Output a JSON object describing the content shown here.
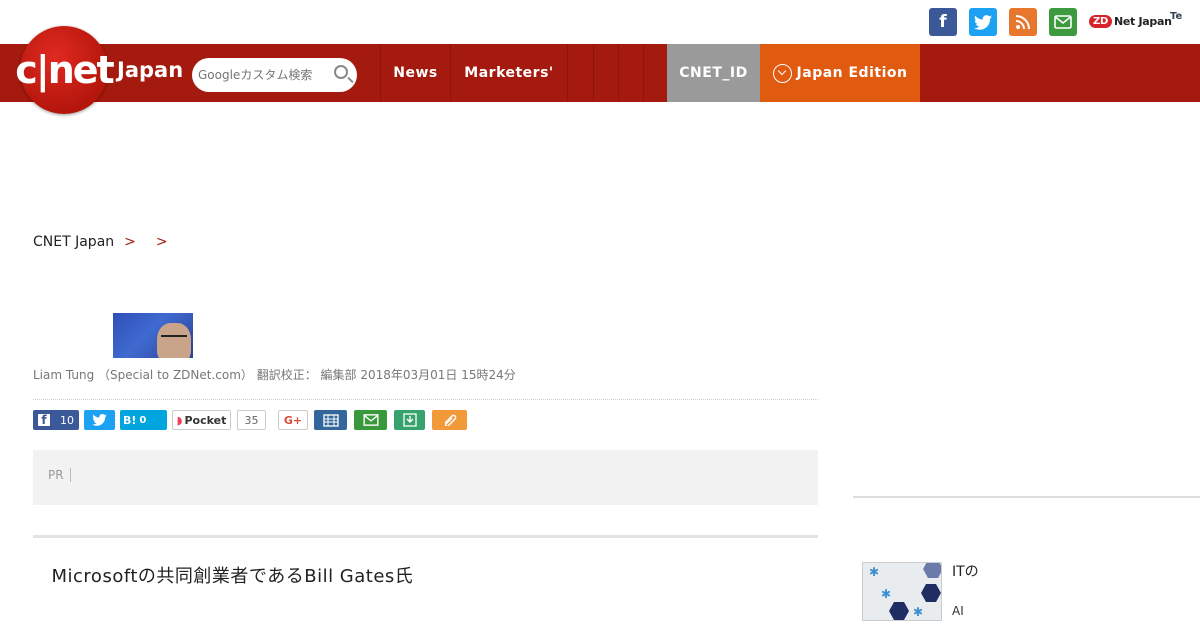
{
  "header": {
    "logo_text": "c|net",
    "edition_label": "Japan",
    "search_placeholder": "Googleカスタム検索",
    "nav": {
      "news": "News",
      "marketers": "Marketers'",
      "e1": "",
      "e2": "",
      "e3": "",
      "e4": "",
      "cnet_id": "CNET_ID",
      "japan_edition": "Japan Edition"
    },
    "social": {
      "zdnet_badge": "ZD",
      "zdnet_text": "Net Japan",
      "tech_text": "Te"
    }
  },
  "breadcrumb": {
    "home": "CNET Japan",
    "sep": ">",
    "level1": "",
    "level2": ""
  },
  "article": {
    "title": "",
    "byline": "Liam Tung （Special to ZDNet.com） 翻訳校正： 編集部  2018年03月01日 15時24分",
    "share": {
      "fb_count": "10",
      "hatena_label": "B!",
      "hatena_count": "0",
      "pocket_label": "Pocket",
      "pocket_count": "35",
      "gplus_label": "G+"
    },
    "pr_tag": "PR",
    "pr_text": "",
    "body": "　Microsoftの共同創業者であるBill Gates氏"
  },
  "sidebar": {
    "heading": "",
    "item_title": "ITの",
    "item_sub1": "",
    "item_sub2": "AI"
  },
  "colors": {
    "brand_red": "#a51a0e",
    "edition_orange": "#e05a10",
    "cnetid_gray": "#9a9a9a"
  }
}
